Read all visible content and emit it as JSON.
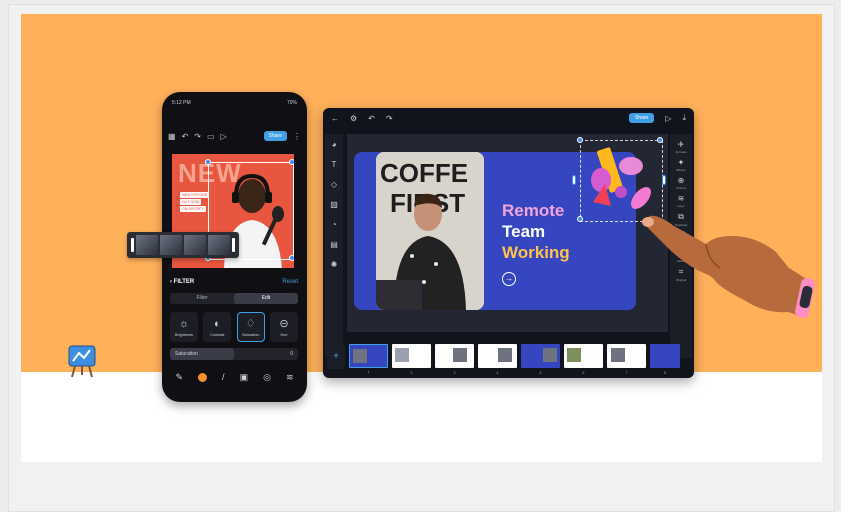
{
  "phone": {
    "status_time": "5:12 PM",
    "status_battery": "70%",
    "share_label": "Share",
    "canvas_headline": "NEW",
    "canvas_tags": [
      "NEW EPISODE",
      "OUT NOW",
      "ON SPOTIFY"
    ],
    "filter_title": "FILTER",
    "filter_reset": "Reset",
    "tabs": [
      "Filter",
      "Edit"
    ],
    "active_tab": "Edit",
    "tools": [
      {
        "label": "Brightness",
        "icon": "sun-icon"
      },
      {
        "label": "Contrast",
        "icon": "contrast-icon"
      },
      {
        "label": "Saturation",
        "icon": "drop-icon"
      },
      {
        "label": "Hue",
        "icon": "hue-icon"
      }
    ],
    "active_tool": "Saturation",
    "slider_label": "Saturation",
    "slider_value": "0"
  },
  "tablet": {
    "share_label": "Share",
    "slide_title_lines": [
      "Remote",
      "Team",
      "Working"
    ],
    "slide_photo_text": "COFFEE FIRST",
    "right_tools": [
      "Animate",
      "Effects",
      "Actions",
      "Layer",
      "Duplicate",
      "Delete",
      "Select",
      "Original"
    ],
    "thumbnail_numbers": [
      "1",
      "2",
      "3",
      "4",
      "5",
      "6",
      "7",
      "8"
    ]
  },
  "colors": {
    "hero_orange": "#ffb15a",
    "accent_blue": "#3fa0e6",
    "slide_blue": "#3546c0",
    "title_pink": "#f4a3d8",
    "title_yellow": "#ffc24d",
    "phone_canvas_red": "#e8563f"
  }
}
